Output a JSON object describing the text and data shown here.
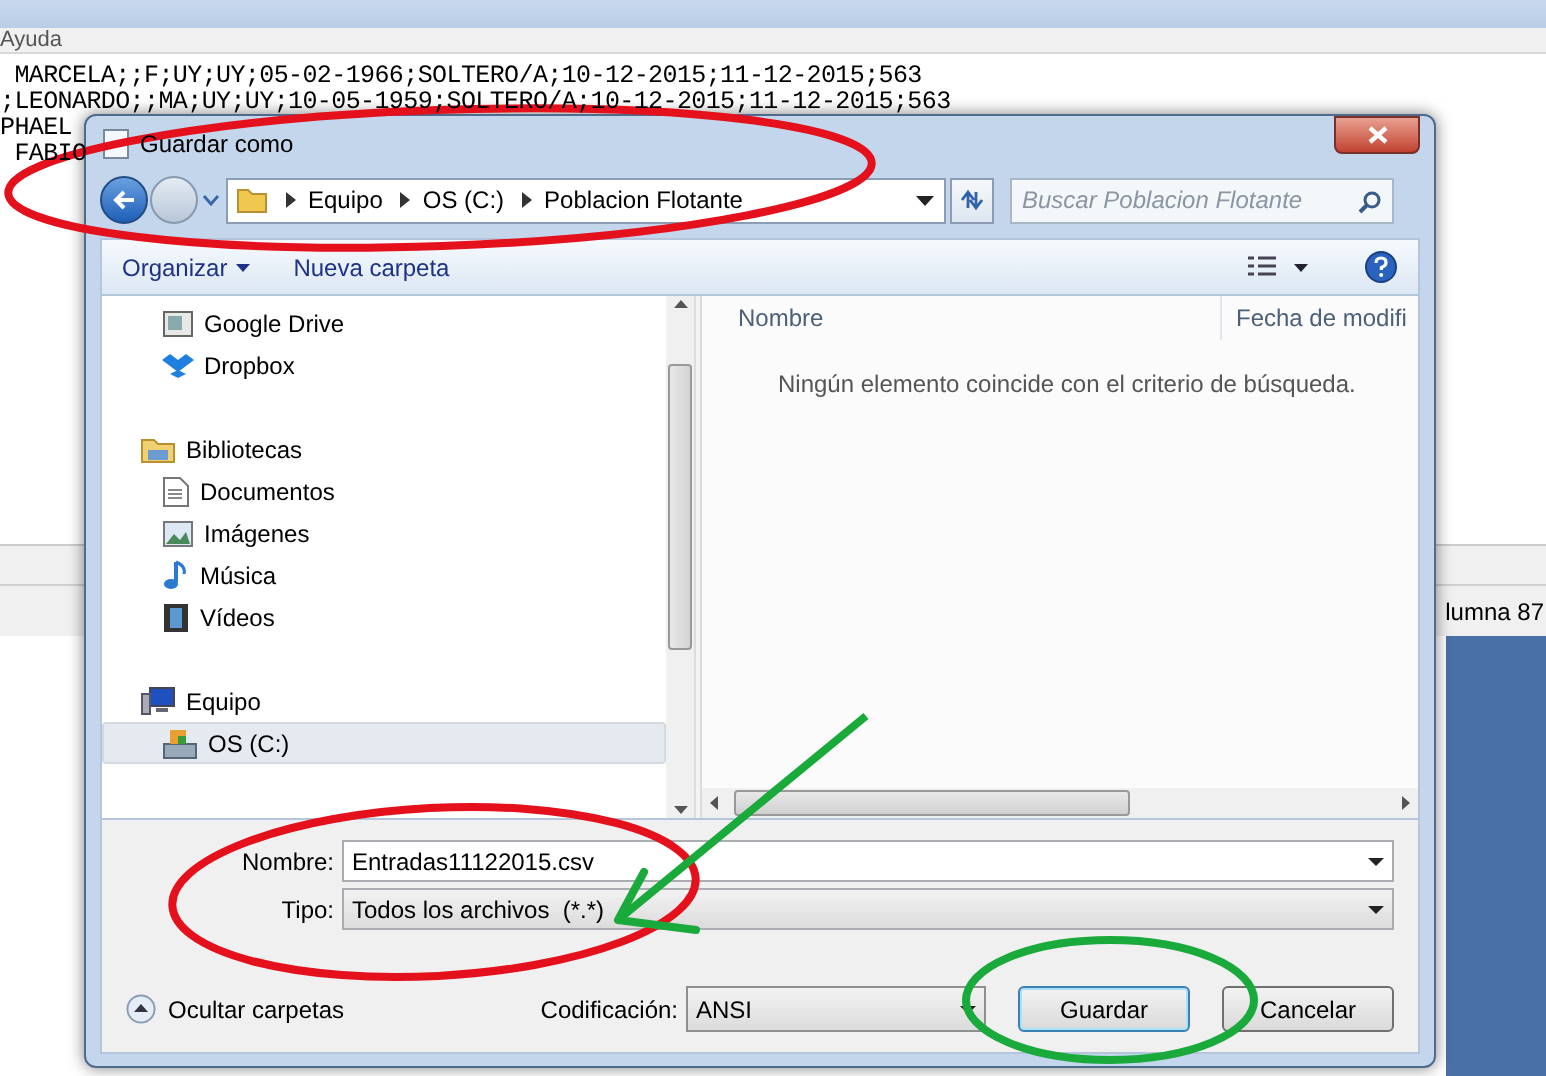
{
  "notepad": {
    "menu_item": "Ayuda",
    "lines": [
      " MARCELA;;F;UY;UY;05-02-1966;SOLTERO/A;10-12-2015;11-12-2015;563",
      ";LEONARDO;;MA;UY;UY;10-05-1959;SOLTERO/A;10-12-2015;11-12-2015;563",
      "PHAEL",
      " FABIO"
    ],
    "status_text": "lumna 87"
  },
  "dialog": {
    "title": "Guardar como",
    "breadcrumb": [
      "Equipo",
      "OS (C:)",
      "Poblacion Flotante"
    ],
    "search": {
      "placeholder": "Buscar Poblacion Flotante"
    },
    "toolbar": [
      "Organizar",
      "Nueva carpeta"
    ],
    "nav_items": [
      {
        "label": "Google Drive",
        "kind": "drive",
        "selected": false
      },
      {
        "label": "Dropbox",
        "kind": "dropbox",
        "selected": false
      },
      {
        "label": "Bibliotecas",
        "kind": "library",
        "selected": false,
        "children": [
          {
            "label": "Documentos",
            "kind": "documents",
            "selected": false
          },
          {
            "label": "Imágenes",
            "kind": "pictures",
            "selected": false
          },
          {
            "label": "Música",
            "kind": "music",
            "selected": false
          },
          {
            "label": "Vídeos",
            "kind": "videos",
            "selected": false
          }
        ]
      },
      {
        "label": "Equipo",
        "kind": "computer",
        "selected": false,
        "children": [
          {
            "label": "OS (C:)",
            "kind": "disk",
            "selected": true
          }
        ]
      }
    ],
    "columns": [
      "Nombre",
      "Fecha de modifi"
    ],
    "empty_message": "Ningún elemento coincide con el criterio de búsqueda.",
    "filename": {
      "label": "Nombre:",
      "value": "Entradas11122015.csv"
    },
    "filetype": {
      "label": "Tipo:",
      "value": "Todos los archivos  (*.*)"
    },
    "hide_folders": "Ocultar carpetas",
    "encoding": {
      "label": "Codificación:",
      "value": "ANSI"
    },
    "buttons": [
      {
        "label": "Guardar",
        "default": true
      },
      {
        "label": "Cancelar",
        "default": false
      }
    ]
  }
}
